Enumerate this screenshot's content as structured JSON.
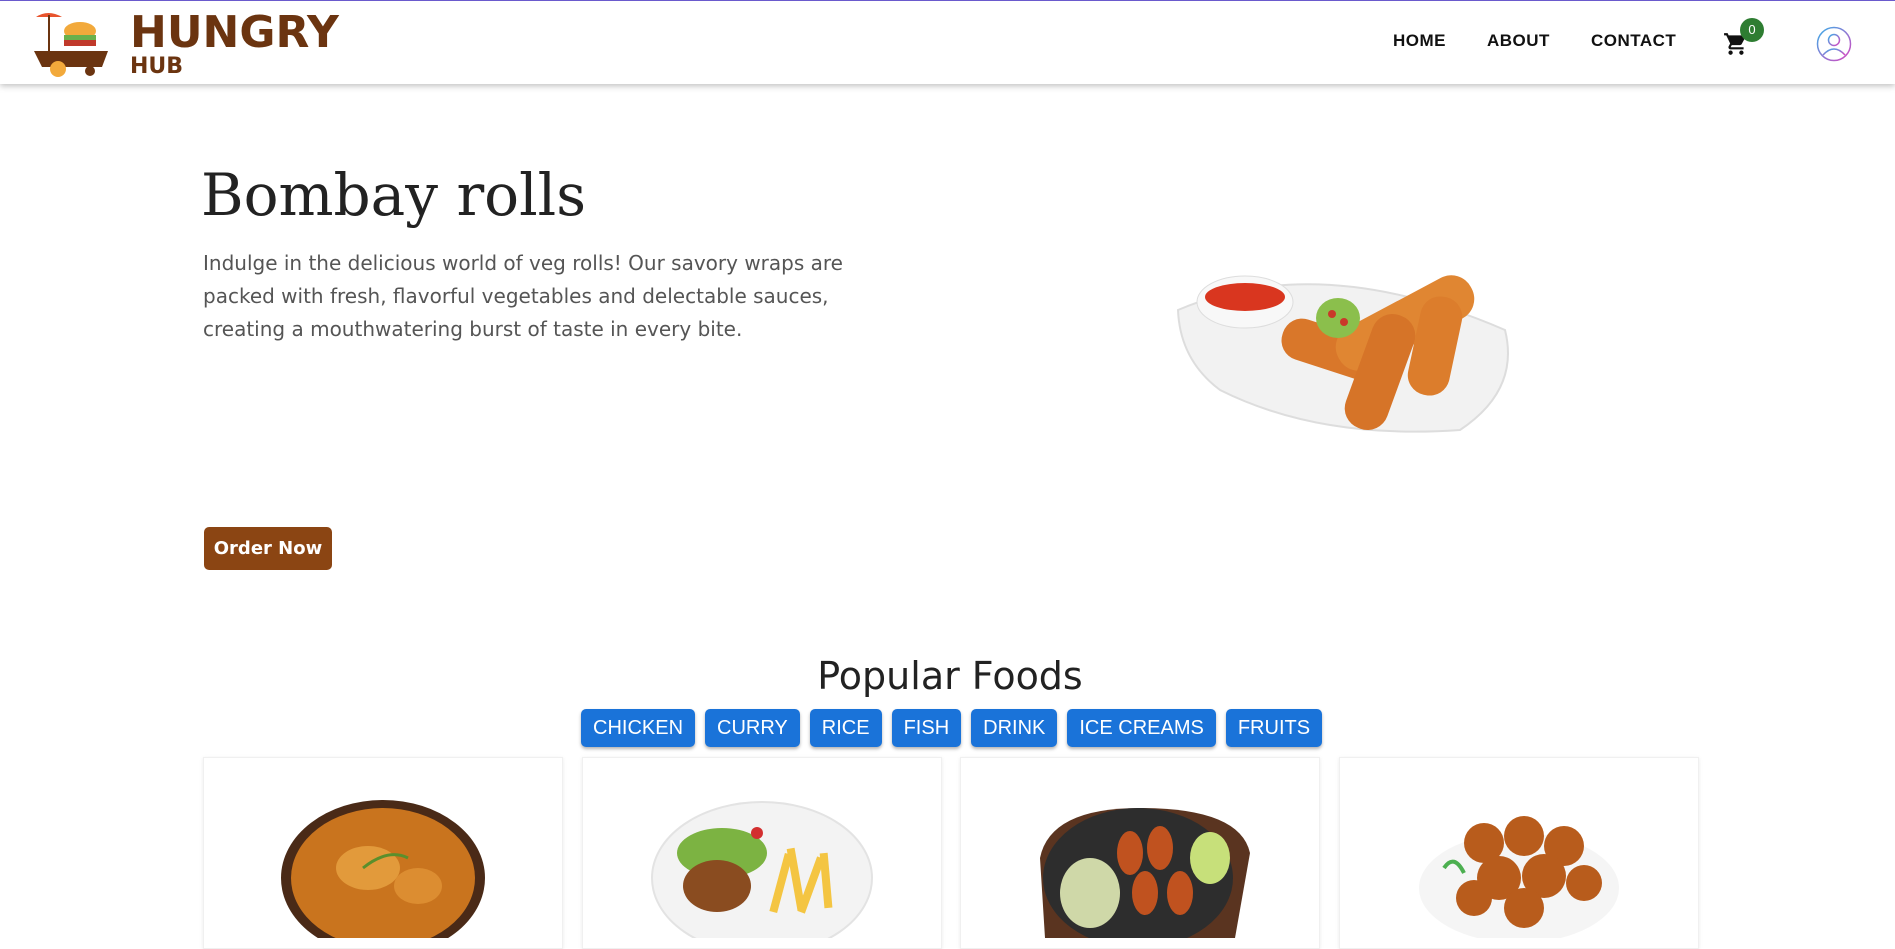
{
  "brand": {
    "line1": "HUNGRY",
    "line2": "HUB"
  },
  "nav": {
    "home": "HOME",
    "about": "ABOUT",
    "contact": "CONTACT",
    "cart_count": "0"
  },
  "hero": {
    "title": "Bombay rolls",
    "description": "Indulge in the delicious world of veg rolls! Our savory wraps are packed with fresh, flavorful vegetables and delectable sauces, creating a mouthwatering burst of taste in every bite.",
    "cta": "Order Now"
  },
  "popular": {
    "title": "Popular Foods",
    "categories": [
      "CHICKEN",
      "CURRY",
      "RICE",
      "FISH",
      "DRINK",
      "ICE CREAMS",
      "FRUITS"
    ]
  },
  "colors": {
    "brand": "#6b3410",
    "cta": "#8b4513",
    "category": "#1a73d9",
    "badge": "#2e7d32"
  },
  "icons": [
    "food-cart-logo-icon",
    "shopping-cart-icon",
    "user-avatar-icon"
  ]
}
